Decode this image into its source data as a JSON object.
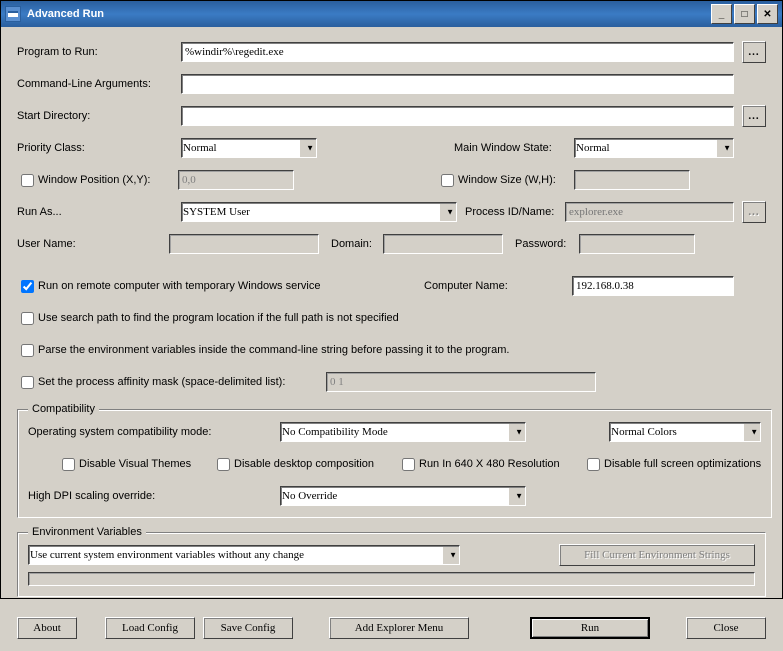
{
  "title": "Advanced Run",
  "labels": {
    "program": "Program to Run:",
    "cmdline": "Command-Line Arguments:",
    "startdir": "Start Directory:",
    "priority": "Priority Class:",
    "mainwin": "Main Window State:",
    "winpos": "Window Position (X,Y):",
    "winsize": "Window Size (W,H):",
    "runas": "Run As...",
    "procid": "Process ID/Name:",
    "username": "User Name:",
    "domain": "Domain:",
    "password": "Password:",
    "remote": "Run on remote computer with temporary Windows service",
    "compname": "Computer Name:",
    "searchpath": "Use search path to find the program location if the full path is not specified",
    "parseenv": "Parse the environment variables inside the command-line string before passing it to the program.",
    "affinity": "Set the process affinity mask (space-delimited list):",
    "compat_legend": "Compatibility",
    "oscompat": "Operating system compatibility mode:",
    "disvis": "Disable Visual Themes",
    "disdesk": "Disable desktop composition",
    "run640": "Run In 640 X 480 Resolution",
    "disfull": "Disable full screen optimizations",
    "hidpi": "High DPI scaling override:",
    "env_legend": "Environment Variables",
    "fillenv": "Fill Current Environment Strings",
    "about": "About",
    "loadcfg": "Load Config",
    "savecfg": "Save Config",
    "addexp": "Add Explorer Menu",
    "run": "Run",
    "close": "Close",
    "browse": "..."
  },
  "values": {
    "program": "%windir%\\regedit.exe",
    "cmdline": "",
    "startdir": "",
    "priority": "Normal",
    "mainwin": "Normal",
    "winpos": "0,0",
    "winsize": "",
    "runas": "SYSTEM User",
    "procid_ph": "explorer.exe",
    "username": "",
    "domain": "",
    "password": "",
    "compname": "192.168.0.38",
    "affinity": "0 1",
    "oscompat": "No Compatibility Mode",
    "colors": "Normal Colors",
    "hidpi": "No Override",
    "envmode": "Use current system environment variables without any change"
  },
  "checks": {
    "winpos": false,
    "winsize": false,
    "remote": true,
    "searchpath": false,
    "parseenv": false,
    "affinity": false,
    "disvis": false,
    "disdesk": false,
    "run640": false,
    "disfull": false
  }
}
